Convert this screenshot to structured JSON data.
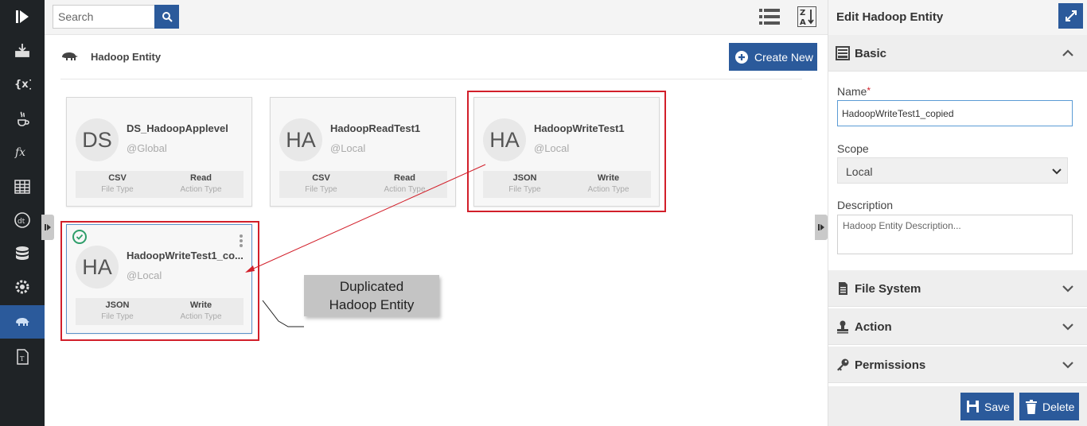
{
  "search": {
    "placeholder": "Search"
  },
  "toolbar": {
    "list_view_icon": "list-view-icon",
    "sort_icon": "sort-z-a-icon"
  },
  "header": {
    "title": "Hadoop Entity",
    "create_label": "Create New",
    "entity_icon": "hadoop-elephant-icon"
  },
  "cards": [
    {
      "initials": "DS",
      "name": "DS_HadoopApplevel",
      "scope": "@Global",
      "file_type": "CSV",
      "file_type_label": "File Type",
      "action_type": "Read",
      "action_type_label": "Action Type"
    },
    {
      "initials": "HA",
      "name": "HadoopReadTest1",
      "scope": "@Local",
      "file_type": "CSV",
      "file_type_label": "File Type",
      "action_type": "Read",
      "action_type_label": "Action Type"
    },
    {
      "initials": "HA",
      "name": "HadoopWriteTest1",
      "scope": "@Local",
      "file_type": "JSON",
      "file_type_label": "File Type",
      "action_type": "Write",
      "action_type_label": "Action Type"
    },
    {
      "initials": "HA",
      "name": "HadoopWriteTest1_co...",
      "scope": "@Local",
      "file_type": "JSON",
      "file_type_label": "File Type",
      "action_type": "Write",
      "action_type_label": "Action Type"
    }
  ],
  "callout": {
    "line1": "Duplicated",
    "line2": "Hadoop Entity"
  },
  "sidebar": {
    "items": [
      {
        "icon": "play-logo-icon"
      },
      {
        "icon": "deploy-icon"
      },
      {
        "icon": "variable-icon"
      },
      {
        "icon": "java-icon"
      },
      {
        "icon": "function-icon"
      },
      {
        "icon": "table-icon"
      },
      {
        "icon": "datatype-icon"
      },
      {
        "icon": "database-icon"
      },
      {
        "icon": "settings-gear-icon"
      },
      {
        "icon": "hadoop-elephant-icon",
        "active": true
      },
      {
        "icon": "text-template-icon"
      }
    ]
  },
  "panel": {
    "title": "Edit Hadoop Entity",
    "sections": {
      "basic": "Basic",
      "file_system": "File System",
      "action": "Action",
      "permissions": "Permissions"
    },
    "name_label": "Name",
    "name_required": "*",
    "name_value": "HadoopWriteTest1_copied",
    "scope_label": "Scope",
    "scope_value": "Local",
    "description_label": "Description",
    "description_placeholder": "Hadoop Entity Description...",
    "save_label": "Save",
    "delete_label": "Delete"
  },
  "colors": {
    "primary": "#2b5a9b",
    "rail": "#1f2326",
    "highlight": "#d21f2a",
    "success": "#2e9e6a"
  }
}
